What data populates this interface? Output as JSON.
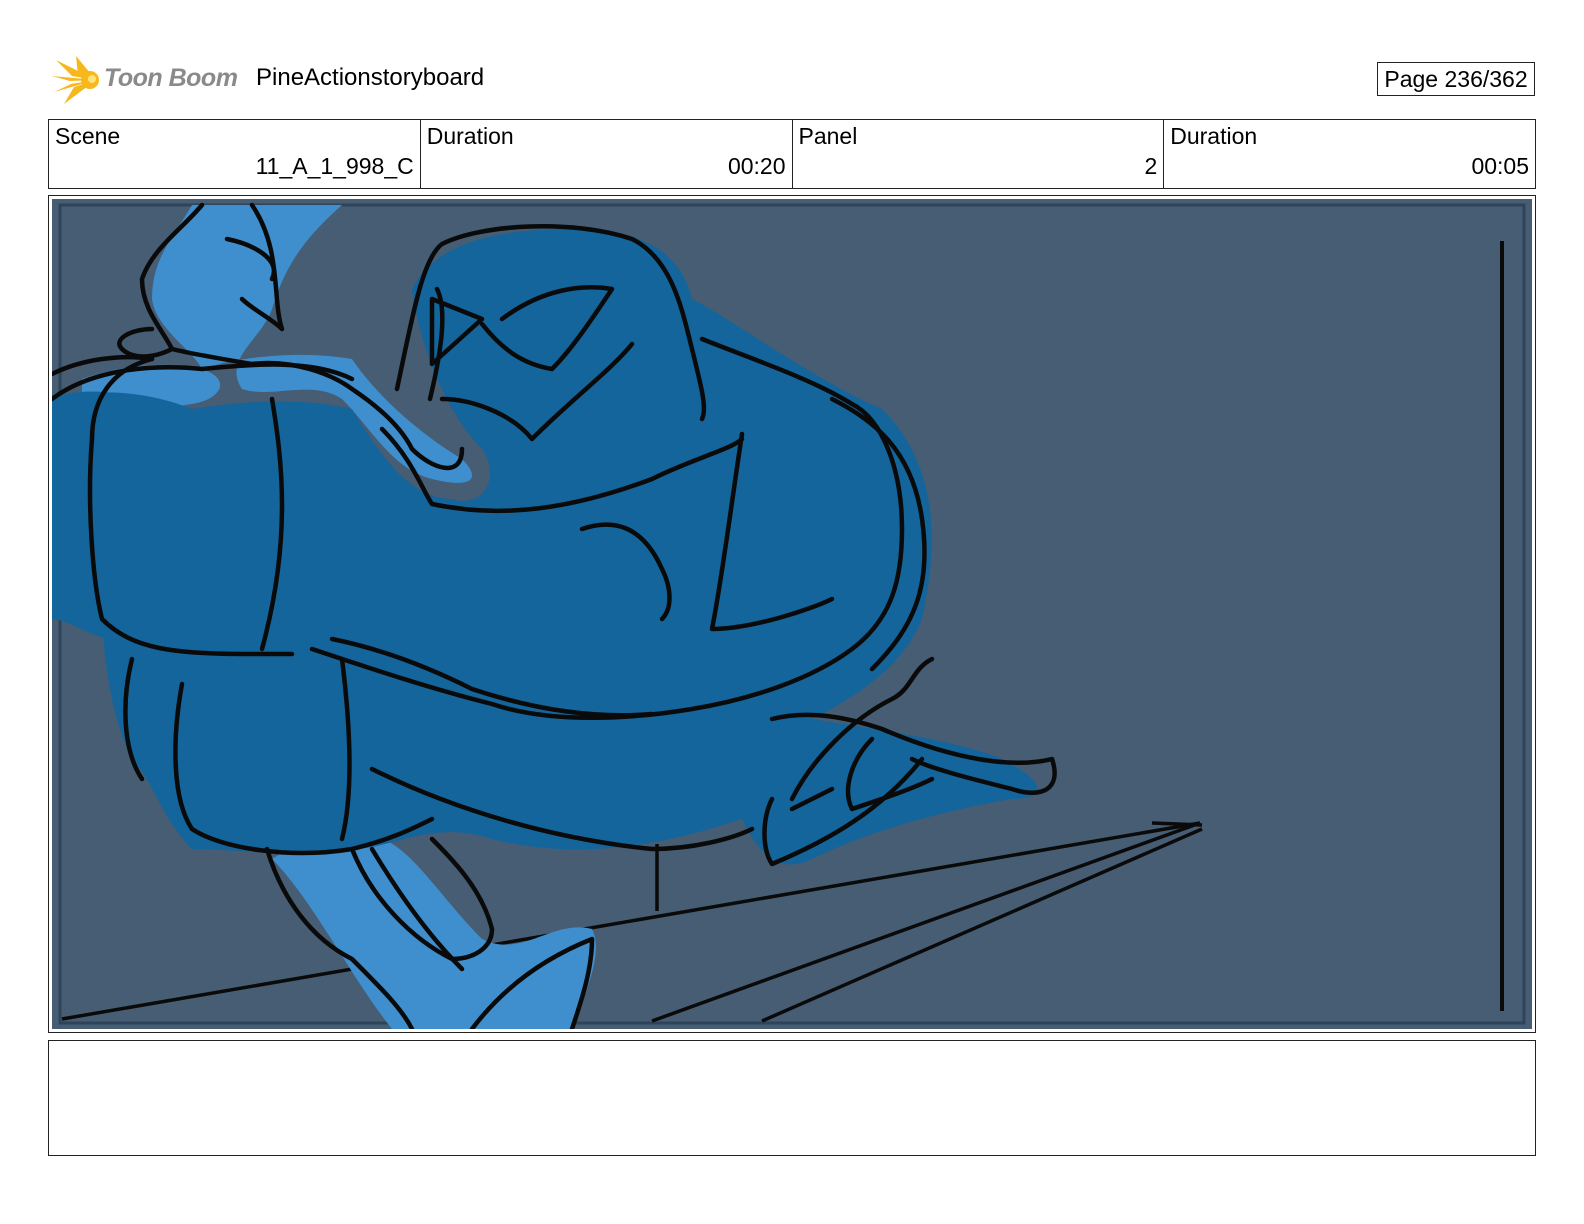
{
  "header": {
    "logo_text": "Toon Boom",
    "project_title": "PineActionstoryboard",
    "page_label": "Page 236/362"
  },
  "info": {
    "scene_label": "Scene",
    "scene_value": "11_A_1_998_C",
    "scene_duration_label": "Duration",
    "scene_duration_value": "00:20",
    "panel_label": "Panel",
    "panel_value": "2",
    "panel_duration_label": "Duration",
    "panel_duration_value": "00:05"
  },
  "colors": {
    "panel_background": "#465d74",
    "character_dark_blue": "#13659c",
    "character_light_blue": "#3f8fce",
    "ink": "#0a0a0a",
    "logo_star": "#f6b81a"
  },
  "notes": ""
}
